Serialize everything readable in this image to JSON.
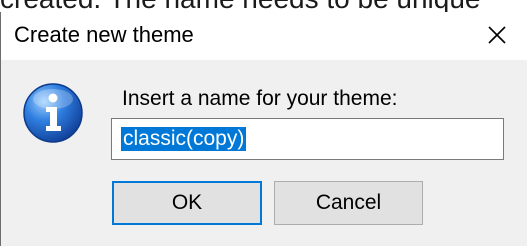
{
  "background": {
    "caption": "created. The name needs to be unique"
  },
  "dialog": {
    "title": "Create new theme",
    "close_glyph": "✕",
    "icon": "info-icon",
    "prompt": "Insert a name for your theme:",
    "input": {
      "value": "classic(copy)",
      "selected": true
    },
    "buttons": {
      "ok": "OK",
      "cancel": "Cancel"
    }
  },
  "colors": {
    "accent": "#0078d7",
    "icon_blue": "#1c5fc4",
    "button_face": "#e1e1e1",
    "dialog_face": "#f0f0f0"
  }
}
